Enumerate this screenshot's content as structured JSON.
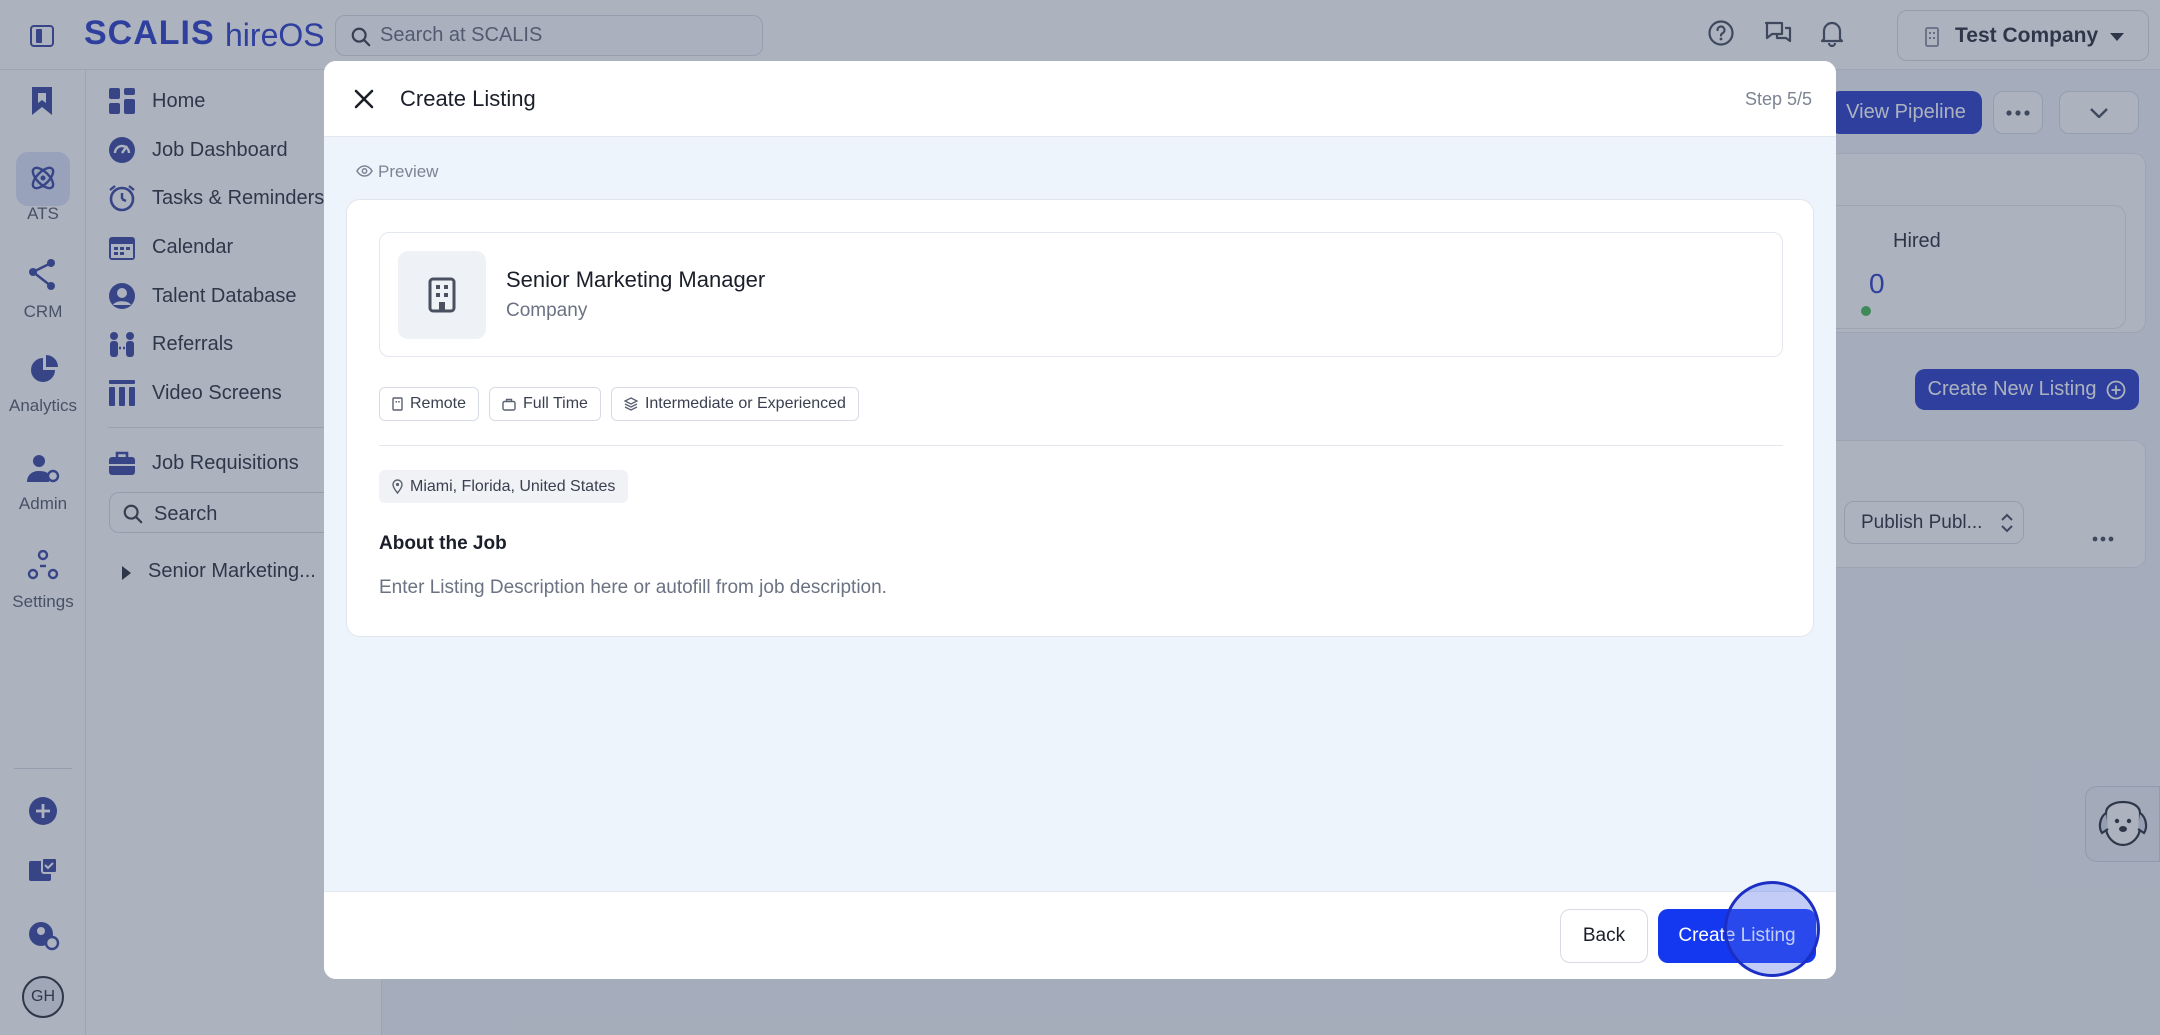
{
  "app": {
    "brand": "SCALIS",
    "product": "hireOS",
    "search_placeholder": "Search at SCALIS",
    "company": "Test Company"
  },
  "rail": {
    "items": [
      {
        "label": "ATS",
        "icon": "atom-icon"
      },
      {
        "label": "CRM",
        "icon": "network-icon"
      },
      {
        "label": "Analytics",
        "icon": "pie-chart-icon"
      },
      {
        "label": "Admin",
        "icon": "user-gear-icon"
      },
      {
        "label": "Settings",
        "icon": "settings-nodes-icon"
      }
    ],
    "avatar_initials": "GH"
  },
  "sidebar": {
    "items": [
      {
        "label": "Home",
        "icon": "home-grid-icon"
      },
      {
        "label": "Job Dashboard",
        "icon": "gauge-icon"
      },
      {
        "label": "Tasks & Reminders",
        "icon": "alarm-clock-icon"
      },
      {
        "label": "Calendar",
        "icon": "calendar-icon"
      },
      {
        "label": "Talent Database",
        "icon": "user-circle-icon"
      },
      {
        "label": "Referrals",
        "icon": "people-icon"
      },
      {
        "label": "Video Screens",
        "icon": "video-bars-icon"
      }
    ],
    "requisitions_label": "Job Requisitions",
    "search_placeholder": "Search",
    "tree_item": "Senior Marketing..."
  },
  "background": {
    "view_pipeline": "View Pipeline",
    "hired_label": "Hired",
    "hired_count": "0",
    "create_new_listing": "Create New Listing",
    "publish_select": "Publish Publ..."
  },
  "modal": {
    "title": "Create Listing",
    "step": "Step 5/5",
    "preview_label": "Preview",
    "job_title": "Senior Marketing Manager",
    "company": "Company",
    "tags": [
      "Remote",
      "Full Time",
      "Intermediate or Experienced"
    ],
    "location": "Miami, Florida, United States",
    "about_heading": "About the Job",
    "description_placeholder": "Enter Listing Description here or autofill from job description.",
    "back_label": "Back",
    "create_label": "Create Listing"
  },
  "colors": {
    "brand": "#1b2fc4",
    "primary_button": "#1437f0",
    "hired_dot": "#3bb54a"
  }
}
